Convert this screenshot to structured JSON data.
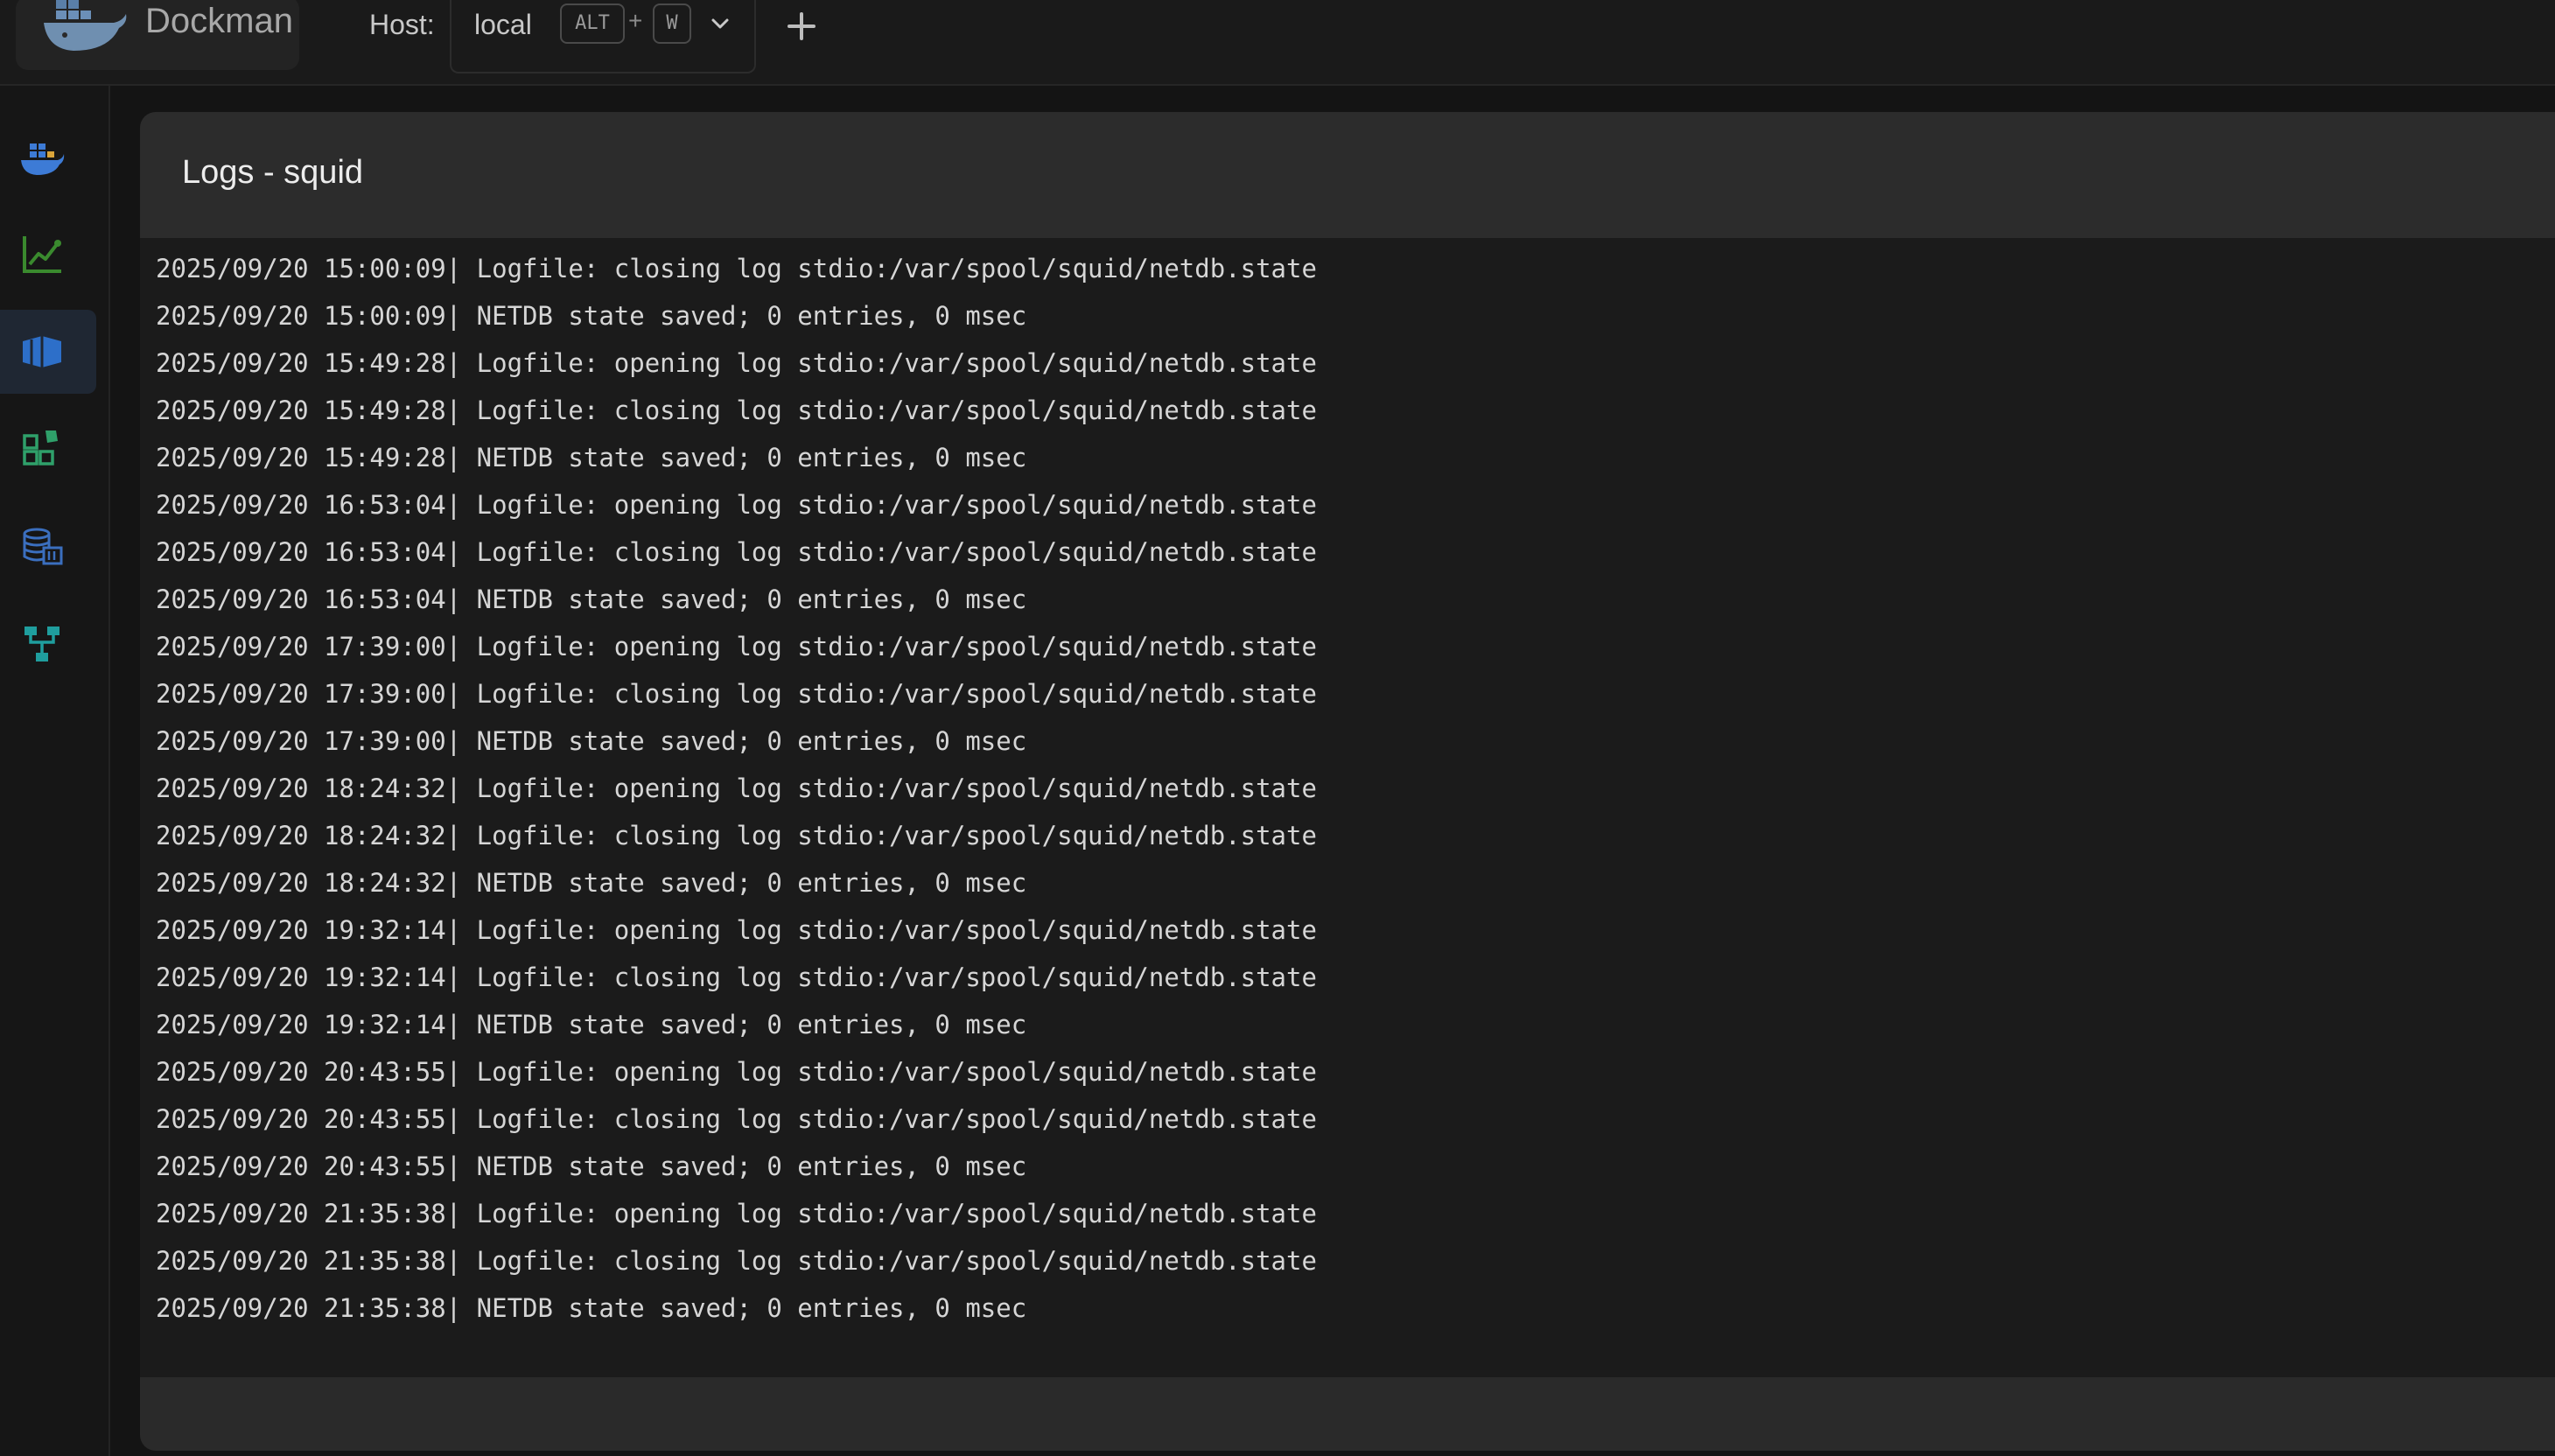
{
  "app": {
    "name": "Dockman"
  },
  "host": {
    "label": "Host:",
    "value": "local",
    "shortcut_modifier": "ALT",
    "shortcut_plus": "+",
    "shortcut_key": "W"
  },
  "sidebar": {
    "items": [
      {
        "icon": "docker-whale-icon",
        "active": false,
        "color": "#3d7bd6"
      },
      {
        "icon": "stats-chart-icon",
        "active": false,
        "color": "#3a8a2e"
      },
      {
        "icon": "containers-icon",
        "active": true,
        "color": "#2d6fc9"
      },
      {
        "icon": "images-icon",
        "active": false,
        "color": "#2fa06a"
      },
      {
        "icon": "volumes-icon",
        "active": false,
        "color": "#3b6fbf"
      },
      {
        "icon": "networks-icon",
        "active": false,
        "color": "#1f9e9e"
      }
    ]
  },
  "panel": {
    "title": "Logs - squid"
  },
  "logs": [
    "2025/09/20 15:00:09| Logfile: closing log stdio:/var/spool/squid/netdb.state",
    "2025/09/20 15:00:09| NETDB state saved; 0 entries, 0 msec",
    "2025/09/20 15:49:28| Logfile: opening log stdio:/var/spool/squid/netdb.state",
    "2025/09/20 15:49:28| Logfile: closing log stdio:/var/spool/squid/netdb.state",
    "2025/09/20 15:49:28| NETDB state saved; 0 entries, 0 msec",
    "2025/09/20 16:53:04| Logfile: opening log stdio:/var/spool/squid/netdb.state",
    "2025/09/20 16:53:04| Logfile: closing log stdio:/var/spool/squid/netdb.state",
    "2025/09/20 16:53:04| NETDB state saved; 0 entries, 0 msec",
    "2025/09/20 17:39:00| Logfile: opening log stdio:/var/spool/squid/netdb.state",
    "2025/09/20 17:39:00| Logfile: closing log stdio:/var/spool/squid/netdb.state",
    "2025/09/20 17:39:00| NETDB state saved; 0 entries, 0 msec",
    "2025/09/20 18:24:32| Logfile: opening log stdio:/var/spool/squid/netdb.state",
    "2025/09/20 18:24:32| Logfile: closing log stdio:/var/spool/squid/netdb.state",
    "2025/09/20 18:24:32| NETDB state saved; 0 entries, 0 msec",
    "2025/09/20 19:32:14| Logfile: opening log stdio:/var/spool/squid/netdb.state",
    "2025/09/20 19:32:14| Logfile: closing log stdio:/var/spool/squid/netdb.state",
    "2025/09/20 19:32:14| NETDB state saved; 0 entries, 0 msec",
    "2025/09/20 20:43:55| Logfile: opening log stdio:/var/spool/squid/netdb.state",
    "2025/09/20 20:43:55| Logfile: closing log stdio:/var/spool/squid/netdb.state",
    "2025/09/20 20:43:55| NETDB state saved; 0 entries, 0 msec",
    "2025/09/20 21:35:38| Logfile: opening log stdio:/var/spool/squid/netdb.state",
    "2025/09/20 21:35:38| Logfile: closing log stdio:/var/spool/squid/netdb.state",
    "2025/09/20 21:35:38| NETDB state saved; 0 entries, 0 msec"
  ]
}
